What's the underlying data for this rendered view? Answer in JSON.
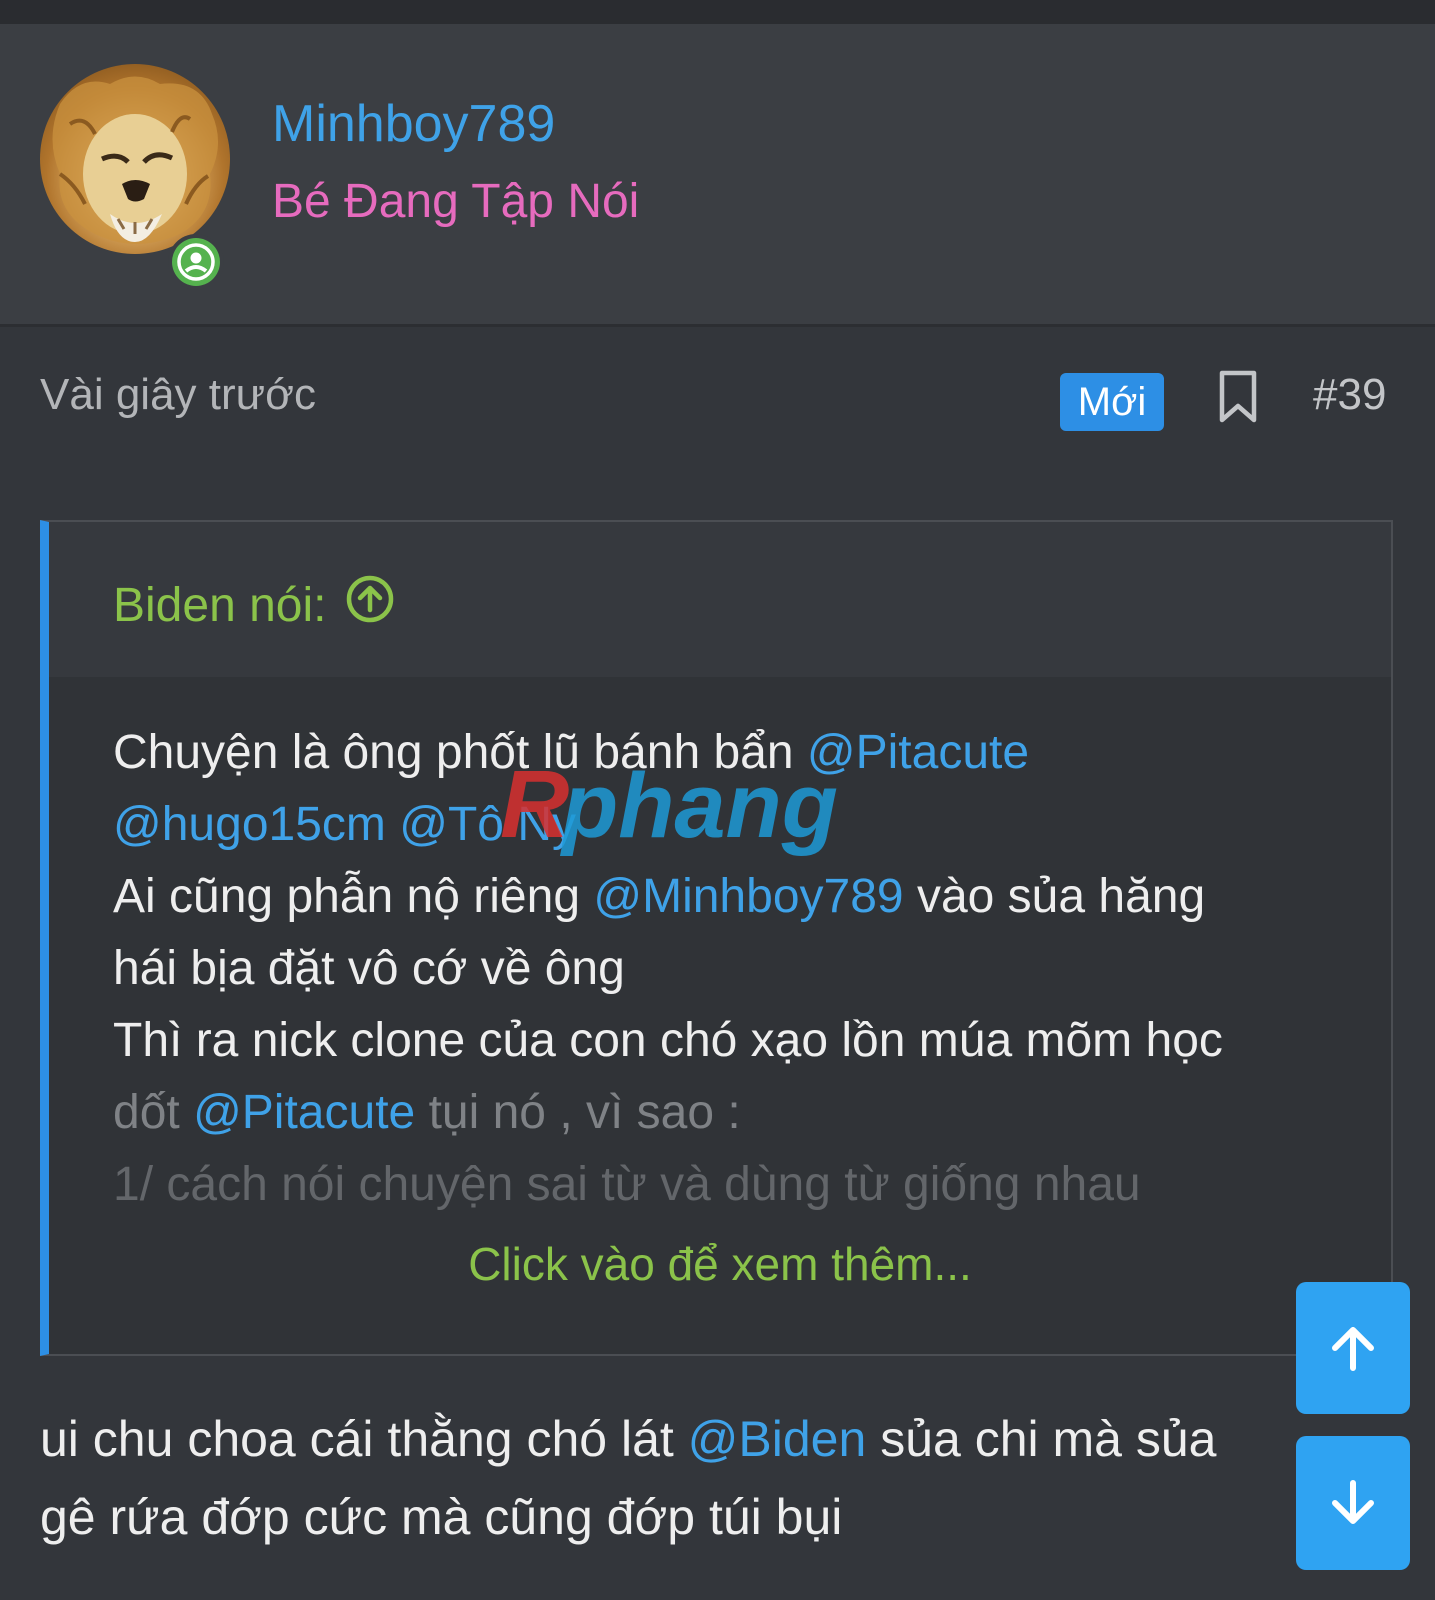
{
  "header": {
    "username": "Minhboy789",
    "user_title": "Bé Đang Tập Nói"
  },
  "meta": {
    "time": "Vài giây trước",
    "badge": "Mới",
    "post_number": "#39"
  },
  "quote": {
    "author": "Biden nói:",
    "lines": [
      {
        "text": "Chuyện là ông phốt lũ bánh bẩn ",
        "mention": "@Pitacute"
      },
      {
        "mention": "@hugo15cm",
        "mention2": "@Tô Ny"
      },
      {
        "text": "Ai cũng phẫn nộ riêng ",
        "mention": "@Minhboy789",
        "after": " vào sủa hăng"
      },
      {
        "text": "hái bịa đặt vô cớ về ông"
      },
      {
        "text": "Thì ra nick clone của con chó xạo lồn múa mõm học"
      },
      {
        "text": "dốt ",
        "mention": "@Pitacute",
        "after": " tụi nó , vì sao :"
      },
      {
        "text": "1/ cách nói chuyện sai từ và dùng từ giống nhau"
      }
    ],
    "expand_label": "Click vào để xem thêm..."
  },
  "watermark": "Rphang",
  "post": {
    "line1_before": "ui chu choa cái thằng chó lát ",
    "line1_mention": "@Biden",
    "line1_after": " sủa chi mà sủa",
    "line2": "gê rứa đớp cức mà cũng đớp túi bụi"
  },
  "colors": {
    "accent": "#2d8fe5",
    "mention": "#3fa2e8",
    "quote_author": "#8bc34a",
    "user_title": "#e66bbe",
    "online": "#55b24e"
  },
  "icons": {
    "online": "user-online-icon",
    "bookmark": "bookmark-icon",
    "jump": "arrow-up-circle-icon",
    "scroll_up": "arrow-up-icon",
    "scroll_down": "arrow-down-icon"
  }
}
